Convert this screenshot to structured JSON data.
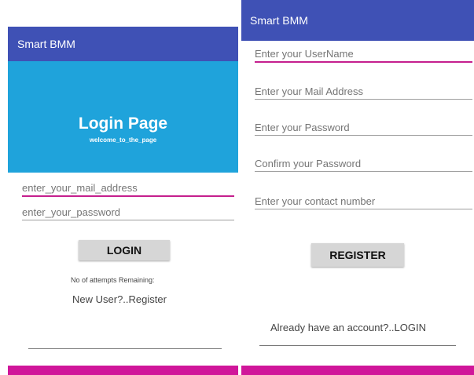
{
  "login_screen": {
    "app_title": "Smart BMM",
    "header": {
      "title": "Login Page",
      "subtitle": "welcome_to_the_page"
    },
    "fields": {
      "email_placeholder": "enter_your_mail_address",
      "password_placeholder": "enter_your_password"
    },
    "login_button": "LOGIN",
    "attempts_label": "No of attempts Remaining:",
    "register_link": "New User?..Register"
  },
  "register_screen": {
    "app_title": "Smart BMM",
    "fields": {
      "username_placeholder": "Enter your UserName",
      "mail_placeholder": "Enter your Mail Address",
      "password_placeholder": "Enter your Password",
      "confirm_password_placeholder": "Confirm your Password",
      "contact_placeholder": "Enter your contact number"
    },
    "register_button": "REGISTER",
    "login_link": "Already have an account?..LOGIN"
  },
  "colors": {
    "app_bar": "#3f51b5",
    "header_background": "#1fa3db",
    "accent": "#c51f8e",
    "bottom_bar": "#d0169a"
  }
}
